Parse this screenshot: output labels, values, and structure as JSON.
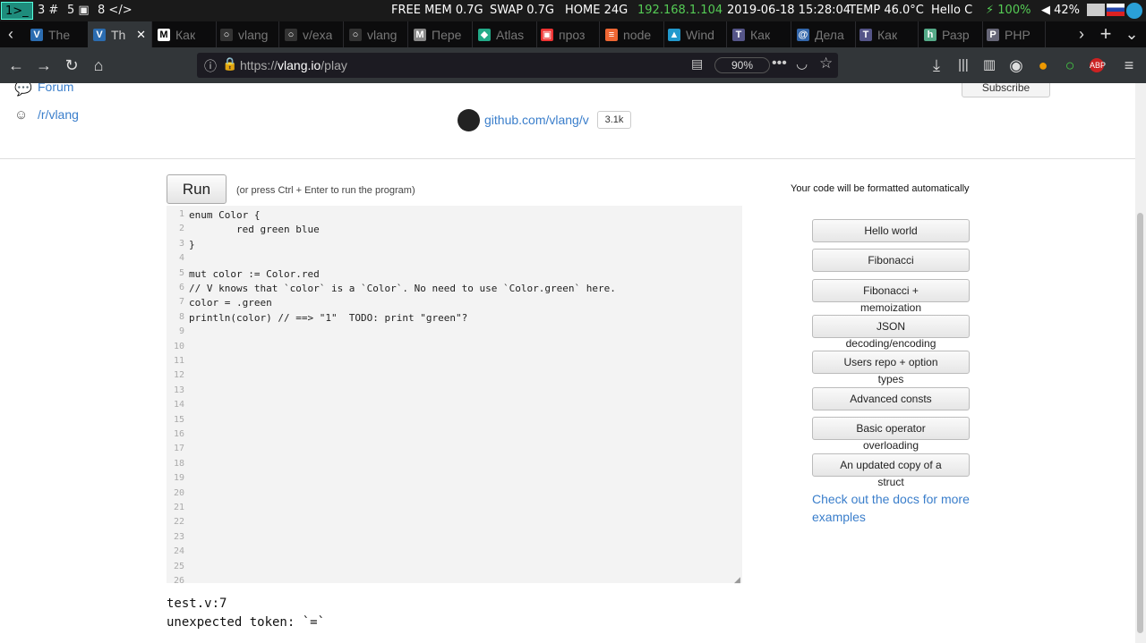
{
  "sysbar": {
    "workspaces": [
      "1",
      "3",
      "5",
      "8"
    ],
    "free_mem": "FREE MEM 0.7G",
    "swap": "SWAP 0.7G",
    "home": "HOME 24G",
    "ip": "192.168.1.104",
    "datetime": "2019-06-18 15:28:04",
    "temp": "TEMP 46.0°C",
    "hello": "Hello C",
    "battery": "100%",
    "volume": "42%"
  },
  "tabs": [
    {
      "fav": "V",
      "title": "The"
    },
    {
      "fav": "V",
      "title": "Th"
    },
    {
      "fav": "M",
      "title": "Как"
    },
    {
      "fav": "○",
      "title": "vlang"
    },
    {
      "fav": "○",
      "title": "v/exa"
    },
    {
      "fav": "○",
      "title": "vlang"
    },
    {
      "fav": "M",
      "title": "Пере"
    },
    {
      "fav": "◆",
      "title": "Atlas"
    },
    {
      "fav": "▣",
      "title": "проз"
    },
    {
      "fav": "≡",
      "title": "node"
    },
    {
      "fav": "▲",
      "title": "Wind"
    },
    {
      "fav": "T",
      "title": "Как"
    },
    {
      "fav": "@",
      "title": "Дела"
    },
    {
      "fav": "T",
      "title": "Как"
    },
    {
      "fav": "h",
      "title": "Разр"
    },
    {
      "fav": "P",
      "title": "PHP"
    }
  ],
  "nav": {
    "url_scheme": "https://",
    "url_host": "vlang.io",
    "url_path": "/play",
    "zoom": "90%"
  },
  "page": {
    "forum_label": "Forum",
    "reddit_label": "/r/vlang",
    "github_label": "github.com/vlang/v",
    "stars": "3.1k",
    "subscribe_label": "Subscribe",
    "run_label": "Run",
    "run_hint": "(or press Ctrl + Enter to run the program)",
    "format_note": "Your code will be formatted automatically",
    "code_lines": [
      "enum Color {",
      "        red green blue",
      "}",
      "",
      "mut color := Color.red",
      "// V knows that `color` is a `Color`. No need to use `Color.green` here.",
      "color = .green",
      "println(color) // ==> \"1\"  TODO: print \"green\"?",
      "",
      "",
      "",
      "",
      "",
      "",
      "",
      "",
      "",
      "",
      "",
      "",
      "",
      "",
      "",
      "",
      "",
      ""
    ],
    "line_numbers": [
      "1",
      "2",
      "3",
      "4",
      "5",
      "6",
      "7",
      "8",
      "9",
      "10",
      "11",
      "12",
      "13",
      "14",
      "15",
      "16",
      "17",
      "18",
      "19",
      "20",
      "21",
      "22",
      "23",
      "24",
      "25",
      "26"
    ],
    "examples": [
      {
        "label": "Hello world",
        "wrap": ""
      },
      {
        "label": "Fibonacci",
        "wrap": ""
      },
      {
        "label": "Fibonacci +",
        "wrap": "memoization"
      },
      {
        "label": "JSON",
        "wrap": "decoding/encoding"
      },
      {
        "label": "Users repo + option",
        "wrap": "types"
      },
      {
        "label": "Advanced consts",
        "wrap": ""
      },
      {
        "label": "Basic operator",
        "wrap": "overloading"
      },
      {
        "label": "An updated copy of a",
        "wrap": "struct"
      }
    ],
    "docs_link": "Check out the docs for more examples",
    "output_line1": "test.v:7",
    "output_line2": "unexpected token: `=`"
  }
}
